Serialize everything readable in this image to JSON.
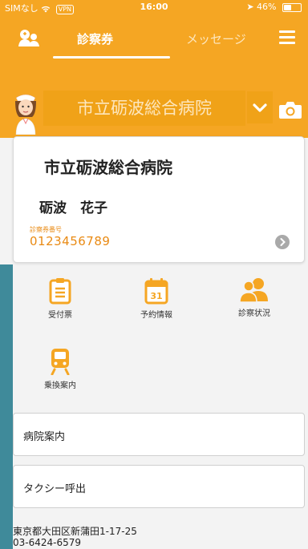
{
  "status_bar": {
    "carrier": "SIMなし",
    "vpn": "VPN",
    "time": "16:00",
    "battery": "46%"
  },
  "nav": {
    "tab_exam": "診察券",
    "tab_message": "メッセージ"
  },
  "hospital_selector": {
    "value": "市立砺波総合病院"
  },
  "card": {
    "hospital_name": "市立砺波総合病院",
    "patient_name": "砺波　花子",
    "number_label": "診察券番号",
    "number": "0123456789"
  },
  "menu": {
    "items": [
      {
        "label": "受付票",
        "icon": "clipboard-icon"
      },
      {
        "label": "予約情報",
        "icon": "calendar-icon",
        "calendar_day": "31"
      },
      {
        "label": "診察状況",
        "icon": "users-icon"
      },
      {
        "label": "乗換案内",
        "icon": "train-icon"
      }
    ]
  },
  "buttons": {
    "hospital_info": "病院案内",
    "taxi": "タクシー呼出"
  },
  "footer": {
    "address": "東京都大田区新蒲田1-17-25",
    "phone": "03-6424-6579"
  },
  "colors": {
    "accent": "#f5a623",
    "accent_dark": "#e98a13",
    "side_strip": "#3f8a9a"
  }
}
